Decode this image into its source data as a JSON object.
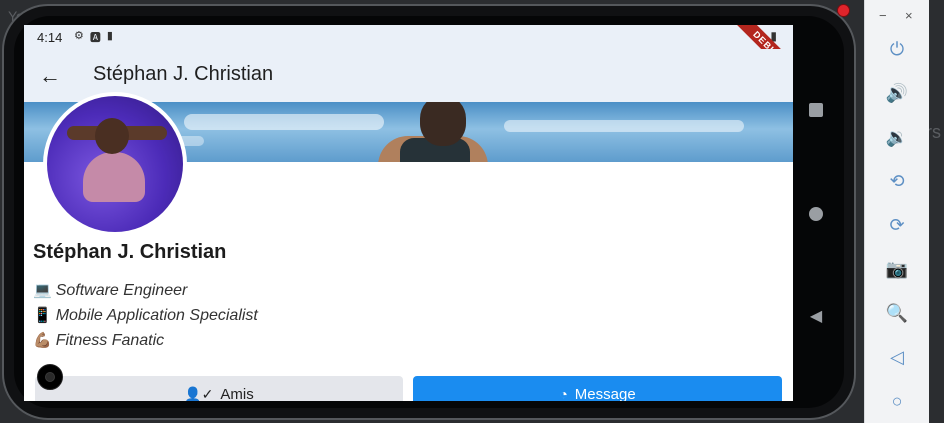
{
  "background": {
    "text_left": "Yo",
    "text_right": "rs"
  },
  "status_bar": {
    "time": "4:14",
    "left_icons": [
      "gear-icon",
      "a-icon",
      "sdcard-icon"
    ],
    "right_icons": [
      "wifi-icon",
      "battery-icon"
    ],
    "debug_label": "DEBUG"
  },
  "app_bar": {
    "back_icon": "arrow-left-icon",
    "title": "Stéphan J. Christian"
  },
  "profile": {
    "name": "Stéphan J. Christian",
    "bio": [
      {
        "emoji": "💻",
        "text": "Software Engineer"
      },
      {
        "emoji": "📱",
        "text": "Mobile Application Specialist"
      },
      {
        "emoji": "💪🏽",
        "text": "Fitness Fanatic"
      }
    ]
  },
  "actions": {
    "friends_label": "Amis",
    "friends_icon": "person-check-icon",
    "message_label": "Message",
    "message_icon": "messenger-icon",
    "message_color": "#1a8cf0",
    "friends_color": "#e4e6eb"
  },
  "emulator_toolbar": {
    "minimize": "−",
    "close": "×",
    "buttons": [
      "power-icon",
      "volume-up-icon",
      "volume-down-icon",
      "rotate-left-icon",
      "rotate-right-icon",
      "camera-icon",
      "zoom-icon",
      "back-icon",
      "home-icon"
    ]
  }
}
